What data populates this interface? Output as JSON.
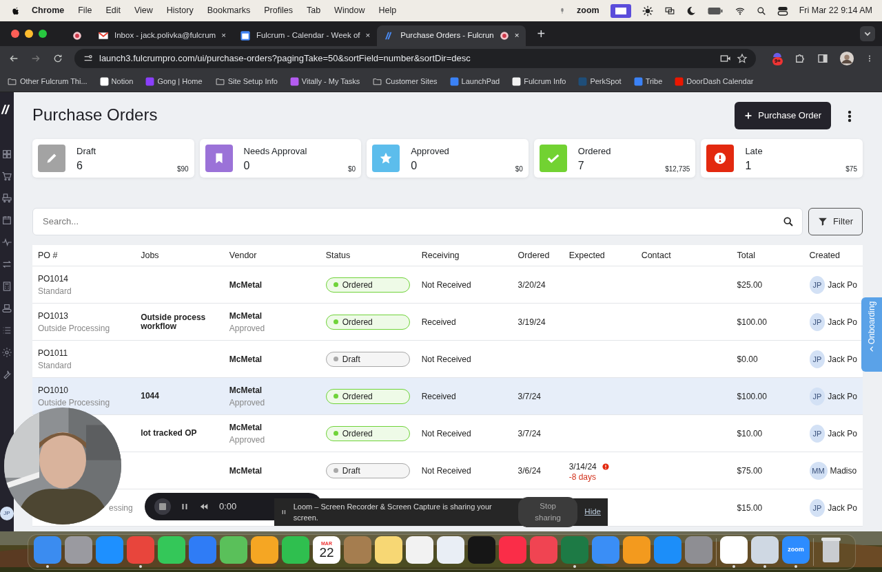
{
  "menubar": {
    "app": "Chrome",
    "menus": [
      "File",
      "Edit",
      "View",
      "History",
      "Bookmarks",
      "Profiles",
      "Tab",
      "Window",
      "Help"
    ],
    "zoom_label": "zoom",
    "clock": "Fri Mar 22  9:14 AM"
  },
  "browser": {
    "tabs": [
      {
        "kind": "pinned",
        "selected": false
      },
      {
        "kind": "mail",
        "title": "Inbox - jack.polivka@fulcrum",
        "close": "×",
        "selected": false
      },
      {
        "kind": "calendar",
        "title": "Fulcrum - Calendar - Week of",
        "close": "×",
        "selected": false
      },
      {
        "kind": "fulcrum",
        "title": "Purchase Orders - Fulcrun",
        "close": "×",
        "selected": true
      }
    ],
    "new_tab": "+",
    "address": "launch3.fulcrumpro.com/ui/purchase-orders?pagingTake=50&sortField=number&sortDir=desc",
    "extension_badge": "9+",
    "bookmarks": [
      {
        "kind": "folder",
        "label": "Other Fulcrum Thi..."
      },
      {
        "kind": "site",
        "label": "Notion",
        "color": "#ffffff"
      },
      {
        "kind": "site",
        "label": "Gong | Home",
        "color": "#8a3ffc"
      },
      {
        "kind": "folder",
        "label": "Site Setup Info"
      },
      {
        "kind": "site",
        "label": "Vitally - My Tasks",
        "color": "#b45cf0"
      },
      {
        "kind": "folder",
        "label": "Customer Sites"
      },
      {
        "kind": "site",
        "label": "LaunchPad",
        "color": "#3b82f6"
      },
      {
        "kind": "site",
        "label": "Fulcrum Info",
        "color": "#f2f2f2"
      },
      {
        "kind": "site",
        "label": "PerkSpot",
        "color": "#1f4e79"
      },
      {
        "kind": "site",
        "label": "Tribe",
        "color": "#3b82f6"
      },
      {
        "kind": "site",
        "label": "DoorDash Calendar",
        "color": "#eb1700"
      }
    ]
  },
  "app": {
    "title": "Purchase Orders",
    "new_button": "Purchase Order",
    "user_initials": "JP",
    "onboarding": "Onboarding",
    "stats": [
      {
        "kind": "pencil",
        "label": "Draft",
        "count": "6",
        "total": "$90",
        "color": "#a3a3a3"
      },
      {
        "kind": "bookmark",
        "label": "Needs Approval",
        "count": "0",
        "total": "$0",
        "color": "#9b72d8"
      },
      {
        "kind": "star",
        "label": "Approved",
        "count": "0",
        "total": "$0",
        "color": "#5cbdec"
      },
      {
        "kind": "check",
        "label": "Ordered",
        "count": "7",
        "total": "$12,735",
        "color": "#72d232"
      },
      {
        "kind": "alert",
        "label": "Late",
        "count": "1",
        "total": "$75",
        "color": "#e3290f"
      }
    ],
    "search": {
      "placeholder": "Search..."
    },
    "filter": "Filter",
    "columns": [
      "PO #",
      "Jobs",
      "Vendor",
      "Status",
      "Receiving",
      "Ordered",
      "Expected",
      "Contact",
      "Total",
      "Created"
    ],
    "rows": [
      {
        "po": "PO1014",
        "po_type": "Standard",
        "job": "",
        "vendor": "McMetal",
        "vendor_status": "",
        "status": {
          "label": "Ordered",
          "color": "#6fd339"
        },
        "receiving": "Not Received",
        "ordered": "3/20/24",
        "expected": "",
        "expected_note": "",
        "total": "$25.00",
        "initials": "JP",
        "creator": "Jack Po",
        "highlighted": false
      },
      {
        "po": "PO1013",
        "po_type": "Outside Processing",
        "job": "Outside process workflow",
        "vendor": "McMetal",
        "vendor_status": "Approved",
        "status": {
          "label": "Ordered",
          "color": "#6fd339"
        },
        "receiving": "Received",
        "ordered": "3/19/24",
        "expected": "",
        "expected_note": "",
        "total": "$100.00",
        "initials": "JP",
        "creator": "Jack Po",
        "highlighted": false
      },
      {
        "po": "PO1011",
        "po_type": "Standard",
        "job": "",
        "vendor": "McMetal",
        "vendor_status": "",
        "status": {
          "label": "Draft",
          "color": "#a8a8a8"
        },
        "receiving": "Not Received",
        "ordered": "",
        "expected": "",
        "expected_note": "",
        "total": "$0.00",
        "initials": "JP",
        "creator": "Jack Po",
        "highlighted": false
      },
      {
        "po": "PO1010",
        "po_type": "Outside Processing",
        "job": "1044",
        "vendor": "McMetal",
        "vendor_status": "Approved",
        "status": {
          "label": "Ordered",
          "color": "#6fd339"
        },
        "receiving": "Received",
        "ordered": "3/7/24",
        "expected": "",
        "expected_note": "",
        "total": "$100.00",
        "initials": "JP",
        "creator": "Jack Po",
        "highlighted": true
      },
      {
        "po": "",
        "po_type": "",
        "job": "lot tracked OP",
        "vendor": "McMetal",
        "vendor_status": "Approved",
        "status": {
          "label": "Ordered",
          "color": "#6fd339"
        },
        "receiving": "Not Received",
        "ordered": "3/7/24",
        "expected": "",
        "expected_note": "",
        "total": "$10.00",
        "initials": "JP",
        "creator": "Jack Po",
        "highlighted": false
      },
      {
        "po": "",
        "po_type": "",
        "job": "",
        "vendor": "McMetal",
        "vendor_status": "",
        "status": {
          "label": "Draft",
          "color": "#a8a8a8"
        },
        "receiving": "Not Received",
        "ordered": "3/6/24",
        "expected": "3/14/24",
        "expected_note": "-8 days",
        "total": "$75.00",
        "initials": "MM",
        "creator": "Madiso",
        "highlighted": false
      },
      {
        "po": "",
        "po_type": "essing",
        "job": "",
        "vendor": "",
        "vendor_status": "",
        "receiving": "",
        "ordered": "",
        "expected": "",
        "expected_note": "",
        "total": "$15.00",
        "initials": "JP",
        "creator": "Jack Po",
        "highlighted": false
      }
    ]
  },
  "recorder": {
    "time": "0:00",
    "message": "Loom – Screen Recorder & Screen Capture is sharing your screen.",
    "stop": "Stop sharing",
    "hide": "Hide"
  },
  "dock": [
    {
      "kind": "app",
      "color": "#3b8cf0",
      "running": true
    },
    {
      "kind": "app",
      "color": "#9a9aa0",
      "running": false
    },
    {
      "kind": "app",
      "color": "#1e90ff",
      "running": false
    },
    {
      "kind": "app",
      "color": "#e8453c",
      "running": true
    },
    {
      "kind": "app",
      "color": "#34c759",
      "running": false
    },
    {
      "kind": "app",
      "color": "#2f7cf6",
      "running": false
    },
    {
      "kind": "app",
      "color": "#5ac05a",
      "running": false
    },
    {
      "kind": "app",
      "color": "#f5a623",
      "running": false
    },
    {
      "kind": "app",
      "color": "#2fbf4f",
      "running": false
    },
    {
      "kind": "calendar",
      "month": "MAR",
      "day": "22",
      "running": false
    },
    {
      "kind": "app",
      "color": "#a57d4f",
      "running": false
    },
    {
      "kind": "app",
      "color": "#f7d774",
      "running": false
    },
    {
      "kind": "app",
      "color": "#f2f2f2",
      "running": false
    },
    {
      "kind": "app",
      "color": "#e9eef5",
      "running": false
    },
    {
      "kind": "app",
      "color": "#161616",
      "running": false
    },
    {
      "kind": "app",
      "color": "#fa2d48",
      "running": false
    },
    {
      "kind": "app",
      "color": "#f04452",
      "running": false
    },
    {
      "kind": "app",
      "color": "#1d7a45",
      "running": true
    },
    {
      "kind": "app",
      "color": "#3a8ef6",
      "running": false
    },
    {
      "kind": "app",
      "color": "#f39a1e",
      "running": false
    },
    {
      "kind": "app",
      "color": "#1c8ef9",
      "running": false
    },
    {
      "kind": "app",
      "color": "#8e8e93",
      "running": false
    },
    {
      "kind": "separator"
    },
    {
      "kind": "app",
      "color": "#ffffff",
      "running": true
    },
    {
      "kind": "app",
      "color": "#cfd8e3",
      "running": true
    },
    {
      "kind": "label",
      "label": "zoom",
      "color": "#2d8cff",
      "running": true
    },
    {
      "kind": "separator"
    },
    {
      "kind": "trash",
      "running": false
    }
  ]
}
